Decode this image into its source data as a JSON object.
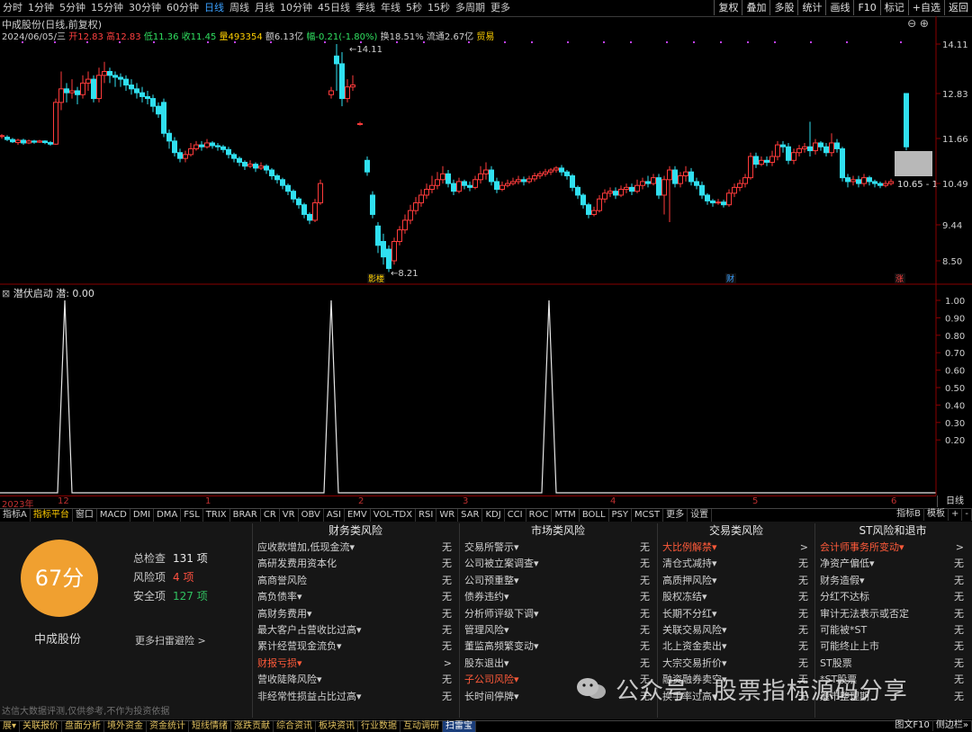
{
  "timeframes": [
    "分时",
    "1分钟",
    "5分钟",
    "15分钟",
    "30分钟",
    "60分钟",
    "日线",
    "周线",
    "月线",
    "10分钟",
    "45日线",
    "季线",
    "年线",
    "5秒",
    "15秒",
    "多周期",
    "更多"
  ],
  "timeframe_active": "日线",
  "right_buttons": [
    "复权",
    "叠加",
    "多股",
    "统计",
    "画线",
    "F10",
    "标记",
    "+自选",
    "返回"
  ],
  "info": {
    "title": "中成股份(日线,前复权)",
    "line2_date": "2024/06/05/三",
    "open": "开12.83",
    "high": "高12.83",
    "low": "低11.36",
    "close": "收11.45",
    "volume": "量493354",
    "amount": "额6.13亿",
    "change": "幅-0.21(-1.80%)",
    "turnover": "换18.51%",
    "float": "流通2.67亿",
    "trade": "贸易"
  },
  "colors": {
    "up": "#ff3b3b",
    "down": "#30e0f0",
    "axis": "#8a0000",
    "accent": "#3aa0ff",
    "score": "#f0a030"
  },
  "price_axis": {
    "ticks": [
      "14.11",
      "12.83",
      "11.66",
      "10.49",
      "9.44",
      "8.50"
    ]
  },
  "price_labels": {
    "high": "14.11",
    "low": "8.21",
    "last": "10.65 - 1"
  },
  "event_markers": [
    "影楼",
    "财",
    "涨"
  ],
  "indicator": {
    "name": "潜伏启动",
    "value_label": "潜: 0.00",
    "ticks": [
      "1.00",
      "0.90",
      "0.80",
      "0.70",
      "0.60",
      "0.50",
      "0.40",
      "0.30",
      "0.20"
    ]
  },
  "timeline": [
    "2023年",
    "12",
    "1",
    "2",
    "3",
    "4",
    "5",
    "6"
  ],
  "timeline_button": "日线",
  "indicator_tabs": [
    "指标A",
    "指标平台",
    "窗口",
    "MACD",
    "DMI",
    "DMA",
    "FSL",
    "TRIX",
    "BRAR",
    "CR",
    "VR",
    "OBV",
    "ASI",
    "EMV",
    "VOL-TDX",
    "RSI",
    "WR",
    "SAR",
    "KDJ",
    "CCI",
    "ROC",
    "MTM",
    "BOLL",
    "PSY",
    "MCST",
    "更多",
    "设置"
  ],
  "indicator_tabs_right": [
    "指标B",
    "模板",
    "+",
    "-"
  ],
  "risk": {
    "score": "67分",
    "stock_name": "中成股份",
    "total_label": "总检查",
    "total_value": "131 项",
    "risk_label": "风险项",
    "risk_value": "4 项",
    "safe_label": "安全项",
    "safe_value": "127 项",
    "more_link": "更多扫雷避险 >",
    "disclaimer": "达信大数据评测,仅供参考,不作为投资依据",
    "columns": [
      {
        "title": "财务类风险",
        "rows": [
          {
            "label": "应收款增加,低现金流▾",
            "status": "无",
            "red": false
          },
          {
            "label": "高研发费用资本化",
            "status": "无",
            "red": false
          },
          {
            "label": "高商誉风险",
            "status": "无",
            "red": false
          },
          {
            "label": "高负债率▾",
            "status": "无",
            "red": false
          },
          {
            "label": "高财务费用▾",
            "status": "无",
            "red": false
          },
          {
            "label": "最大客户占营收比过高▾",
            "status": "无",
            "red": false
          },
          {
            "label": "累计经营现金流负▾",
            "status": "无",
            "red": false
          },
          {
            "label": "财报亏损▾",
            "status": ">",
            "red": true
          },
          {
            "label": "营收陡降风险▾",
            "status": "无",
            "red": false
          },
          {
            "label": "非经常性损益占比过高▾",
            "status": "无",
            "red": false
          }
        ]
      },
      {
        "title": "市场类风险",
        "rows": [
          {
            "label": "交易所警示▾",
            "status": "无",
            "red": false
          },
          {
            "label": "公司被立案调查▾",
            "status": "无",
            "red": false
          },
          {
            "label": "公司预重整▾",
            "status": "无",
            "red": false
          },
          {
            "label": "债券违约▾",
            "status": "无",
            "red": false
          },
          {
            "label": "分析师评级下调▾",
            "status": "无",
            "red": false
          },
          {
            "label": "管理风险▾",
            "status": "无",
            "red": false
          },
          {
            "label": "董监高频繁变动▾",
            "status": "无",
            "red": false
          },
          {
            "label": "股东退出▾",
            "status": "无",
            "red": false
          },
          {
            "label": "子公司风险▾",
            "status": "无",
            "red": true
          },
          {
            "label": "长时间停牌▾",
            "status": "无",
            "red": false
          }
        ]
      },
      {
        "title": "交易类风险",
        "rows": [
          {
            "label": "大比例解禁▾",
            "status": ">",
            "red": true
          },
          {
            "label": "清仓式减持▾",
            "status": "无",
            "red": false
          },
          {
            "label": "高质押风险▾",
            "status": "无",
            "red": false
          },
          {
            "label": "股权冻结▾",
            "status": "无",
            "red": false
          },
          {
            "label": "长期不分红▾",
            "status": "无",
            "red": false
          },
          {
            "label": "关联交易风险▾",
            "status": "无",
            "red": false
          },
          {
            "label": "北上资金卖出▾",
            "status": "无",
            "red": false
          },
          {
            "label": "大宗交易折价▾",
            "status": "无",
            "red": false
          },
          {
            "label": "融资融券卖空▾",
            "status": "无",
            "red": false
          },
          {
            "label": "换手率过高▾",
            "status": "无",
            "red": false
          }
        ]
      },
      {
        "title": "ST风险和退市",
        "rows": [
          {
            "label": "会计师事务所变动▾",
            "status": ">",
            "red": true
          },
          {
            "label": "净资产偏低▾",
            "status": "无",
            "red": false
          },
          {
            "label": "财务造假▾",
            "status": "无",
            "red": false
          },
          {
            "label": "分红不达标",
            "status": "无",
            "red": false
          },
          {
            "label": "审计无法表示或否定",
            "status": "无",
            "red": false
          },
          {
            "label": "可能被*ST",
            "status": "无",
            "red": false
          },
          {
            "label": "可能终止上市",
            "status": "无",
            "red": false
          },
          {
            "label": "ST股票",
            "status": "无",
            "red": false
          },
          {
            "label": "*ST股票",
            "status": "无",
            "red": false
          },
          {
            "label": "退市整理期",
            "status": "无",
            "red": false
          }
        ]
      }
    ]
  },
  "bottom_nav": [
    "展▾",
    "关联报价",
    "盘面分析",
    "境外资金",
    "资金统计",
    "短线情绪",
    "涨跌贡献",
    "综合资讯",
    "板块资讯",
    "行业数据",
    "互动调研",
    "扫雷宝"
  ],
  "bottom_nav_active": "扫雷宝",
  "bottom_nav_right": [
    "图文F10",
    "侧边栏»"
  ],
  "watermark": "公众号 · 股票指标源码分享"
}
